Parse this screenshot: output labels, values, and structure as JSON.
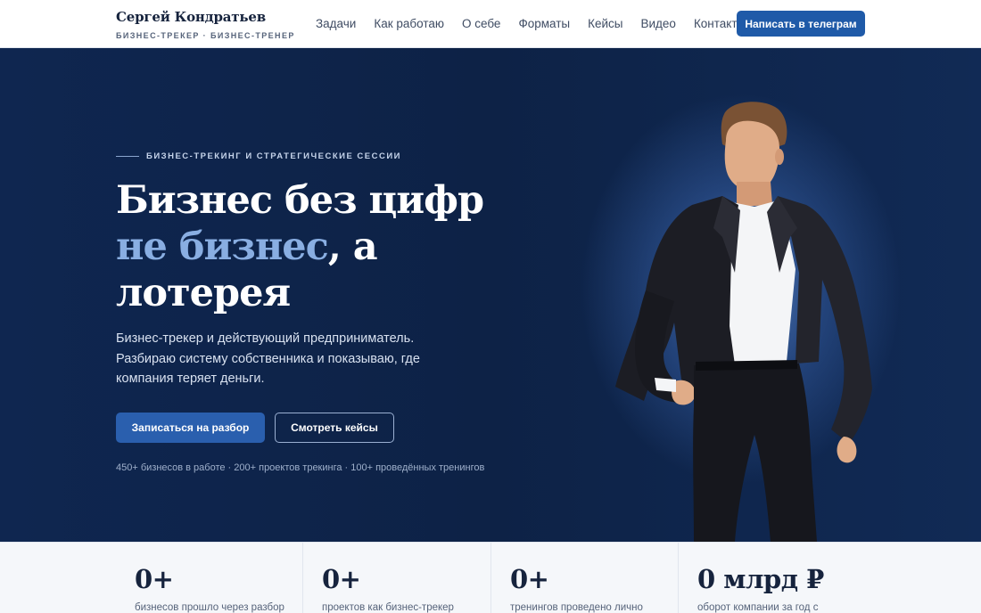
{
  "header": {
    "brand_name": "Сергей Кондратьев",
    "brand_subtitle": "БИЗНЕС-ТРЕКЕР · БИЗНЕС-ТРЕНЕР",
    "nav": [
      "Задачи",
      "Как работаю",
      "О себе",
      "Форматы",
      "Кейсы",
      "Видео",
      "Контакты"
    ],
    "cta_label": "Написать в телеграм"
  },
  "hero": {
    "eyebrow": "БИЗНЕС-ТРЕКИНГ И СТРАТЕГИЧЕСКИЕ СЕССИИ",
    "headline_line1": "Бизнес без цифр",
    "headline_accent": "не бизнес",
    "headline_line2_rest": ", а",
    "headline_line3": "лотерея",
    "lead": "Бизнес-трекер и действующий предприниматель. Разбираю систему собственника и показываю, где компания теряет деньги.",
    "primary_button": "Записаться на разбор",
    "secondary_button": "Смотреть кейсы",
    "stats_line": "450+ бизнесов в работе · 200+ проектов трекинга · 100+ проведённых тренингов"
  },
  "stats": [
    {
      "value": "0+",
      "label": "бизнесов прошло через разбор"
    },
    {
      "value": "0+",
      "label": "проектов как бизнес-трекер"
    },
    {
      "value": "0+",
      "label": "тренингов проведено лично"
    },
    {
      "value": "0 млрд ₽",
      "label": "оборот компании за год с"
    }
  ],
  "colors": {
    "brand_blue": "#1f5aa8",
    "hero_navy": "#0e2448",
    "accent_light_blue": "#89aee2"
  }
}
